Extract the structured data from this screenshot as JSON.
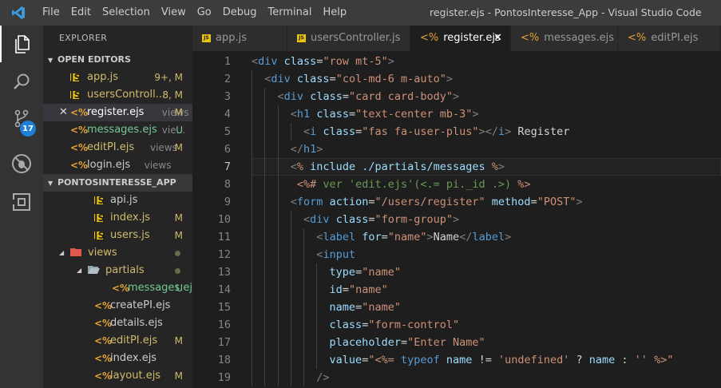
{
  "app": {
    "menu": [
      "File",
      "Edit",
      "Selection",
      "View",
      "Go",
      "Debug",
      "Terminal",
      "Help"
    ],
    "window_title": "register.ejs - PontosInteresse_App - Visual Studio Code"
  },
  "activity_bar": {
    "items": [
      {
        "icon": "files-icon",
        "active": true
      },
      {
        "icon": "search-icon",
        "active": false
      },
      {
        "icon": "source-control-icon",
        "active": false,
        "badge": "17"
      },
      {
        "icon": "debug-icon",
        "active": false
      },
      {
        "icon": "extensions-icon",
        "active": false
      }
    ]
  },
  "sidebar": {
    "title": "EXPLORER",
    "open_editors": {
      "title": "OPEN EDITORS",
      "items": [
        {
          "type": "js",
          "name": "app.js",
          "dir": "",
          "status": "9+, M"
        },
        {
          "type": "js",
          "name": "usersControll...",
          "dir": "",
          "status": "8, M"
        },
        {
          "type": "ejs",
          "name": "register.ejs",
          "dir": "views",
          "status": "M",
          "selected": true,
          "close": "✕"
        },
        {
          "type": "ejs",
          "name": "messages.ejs",
          "dir": "vie...",
          "status": "U"
        },
        {
          "type": "ejs",
          "name": "editPI.ejs",
          "dir": "views",
          "status": "M"
        },
        {
          "type": "ejs",
          "name": "login.ejs",
          "dir": "views",
          "status": ""
        }
      ]
    },
    "project": {
      "title": "PONTOSINTERESSE_APP",
      "items": [
        {
          "type": "js",
          "name": "api.js",
          "indent": 1,
          "status": ""
        },
        {
          "type": "js",
          "name": "index.js",
          "indent": 1,
          "status": "M"
        },
        {
          "type": "js",
          "name": "users.js",
          "indent": 1,
          "status": "M"
        },
        {
          "type": "folder-red",
          "name": "views",
          "indent": 0,
          "status": "dot",
          "open": true
        },
        {
          "type": "folder",
          "name": "partials",
          "indent": 1,
          "status": "dot",
          "open": true
        },
        {
          "type": "ejs",
          "name": "messages.ejs",
          "indent": 2,
          "status": "U"
        },
        {
          "type": "ejs",
          "name": "createPI.ejs",
          "indent": 1,
          "status": ""
        },
        {
          "type": "ejs",
          "name": "details.ejs",
          "indent": 1,
          "status": ""
        },
        {
          "type": "ejs",
          "name": "editPI.ejs",
          "indent": 1,
          "status": "M"
        },
        {
          "type": "ejs",
          "name": "index.ejs",
          "indent": 1,
          "status": ""
        },
        {
          "type": "ejs",
          "name": "layout.ejs",
          "indent": 1,
          "status": "M"
        }
      ]
    }
  },
  "tabs": [
    {
      "type": "js",
      "label": "app.js",
      "active": false
    },
    {
      "type": "js",
      "label": "usersController.js",
      "active": false
    },
    {
      "type": "ejs",
      "label": "register.ejs",
      "active": true,
      "close": "✕"
    },
    {
      "type": "ejs",
      "label": "messages.ejs",
      "active": false
    },
    {
      "type": "ejs",
      "label": "editPI.ejs",
      "active": false
    }
  ],
  "editor": {
    "current_line": 7,
    "lines": [
      {
        "n": "1",
        "ind": 0,
        "t": [
          [
            "p",
            "<"
          ],
          [
            "t",
            "div"
          ],
          [
            "x",
            " "
          ],
          [
            "a",
            "class"
          ],
          [
            "x",
            "="
          ],
          [
            "s",
            "\"row mt-5\""
          ],
          [
            "p",
            ">"
          ]
        ]
      },
      {
        "n": "2",
        "ind": 1,
        "t": [
          [
            "p",
            "<"
          ],
          [
            "t",
            "div"
          ],
          [
            "x",
            " "
          ],
          [
            "a",
            "class"
          ],
          [
            "x",
            "="
          ],
          [
            "s",
            "\"col-md-6 m-auto\""
          ],
          [
            "p",
            ">"
          ]
        ]
      },
      {
        "n": "3",
        "ind": 2,
        "t": [
          [
            "p",
            "<"
          ],
          [
            "t",
            "div"
          ],
          [
            "x",
            " "
          ],
          [
            "a",
            "class"
          ],
          [
            "x",
            "="
          ],
          [
            "s",
            "\"card card-body\""
          ],
          [
            "p",
            ">"
          ]
        ]
      },
      {
        "n": "4",
        "ind": 3,
        "t": [
          [
            "p",
            "<"
          ],
          [
            "t",
            "h1"
          ],
          [
            "x",
            " "
          ],
          [
            "a",
            "class"
          ],
          [
            "x",
            "="
          ],
          [
            "s",
            "\"text-center mb-3\""
          ],
          [
            "p",
            ">"
          ]
        ]
      },
      {
        "n": "5",
        "ind": 4,
        "t": [
          [
            "p",
            "<"
          ],
          [
            "t",
            "i"
          ],
          [
            "x",
            " "
          ],
          [
            "a",
            "class"
          ],
          [
            "x",
            "="
          ],
          [
            "s",
            "\"fas fa-user-plus\""
          ],
          [
            "p",
            ">"
          ],
          [
            "p",
            "</"
          ],
          [
            "t",
            "i"
          ],
          [
            "p",
            ">"
          ],
          [
            "x",
            " Register"
          ]
        ]
      },
      {
        "n": "6",
        "ind": 3,
        "t": [
          [
            "p",
            "</"
          ],
          [
            "t",
            "h1"
          ],
          [
            "p",
            ">"
          ]
        ]
      },
      {
        "n": "7",
        "ind": 3,
        "t": [
          [
            "p",
            "<"
          ],
          [
            "ed",
            "%"
          ],
          [
            "a",
            " include ./partials/messages "
          ],
          [
            "ed",
            "%"
          ],
          [
            "p",
            ">"
          ]
        ]
      },
      {
        "n": "8",
        "ind": 3,
        "t": [
          [
            "x",
            " "
          ],
          [
            "ed",
            "<%#"
          ],
          [
            "c",
            " ver 'edit.ejs'(<.= pi._id .>) "
          ],
          [
            "ed",
            "%>"
          ]
        ]
      },
      {
        "n": "9",
        "ind": 3,
        "t": [
          [
            "p",
            "<"
          ],
          [
            "t",
            "form"
          ],
          [
            "x",
            " "
          ],
          [
            "a",
            "action"
          ],
          [
            "x",
            "="
          ],
          [
            "s",
            "\"/users/register\""
          ],
          [
            "x",
            " "
          ],
          [
            "a",
            "method"
          ],
          [
            "x",
            "="
          ],
          [
            "s",
            "\"POST\""
          ],
          [
            "p",
            ">"
          ]
        ]
      },
      {
        "n": "10",
        "ind": 4,
        "t": [
          [
            "p",
            "<"
          ],
          [
            "t",
            "div"
          ],
          [
            "x",
            " "
          ],
          [
            "a",
            "class"
          ],
          [
            "x",
            "="
          ],
          [
            "s",
            "\"form-group\""
          ],
          [
            "p",
            ">"
          ]
        ]
      },
      {
        "n": "11",
        "ind": 5,
        "t": [
          [
            "p",
            "<"
          ],
          [
            "t",
            "label"
          ],
          [
            "x",
            " "
          ],
          [
            "a",
            "for"
          ],
          [
            "x",
            "="
          ],
          [
            "s",
            "\"name\""
          ],
          [
            "p",
            ">"
          ],
          [
            "x",
            "Name"
          ],
          [
            "p",
            "</"
          ],
          [
            "t",
            "label"
          ],
          [
            "p",
            ">"
          ]
        ]
      },
      {
        "n": "12",
        "ind": 5,
        "t": [
          [
            "p",
            "<"
          ],
          [
            "t",
            "input"
          ]
        ]
      },
      {
        "n": "13",
        "ind": 6,
        "t": [
          [
            "a",
            "type"
          ],
          [
            "x",
            "="
          ],
          [
            "s",
            "\"name\""
          ]
        ]
      },
      {
        "n": "14",
        "ind": 6,
        "t": [
          [
            "a",
            "id"
          ],
          [
            "x",
            "="
          ],
          [
            "s",
            "\"name\""
          ]
        ]
      },
      {
        "n": "15",
        "ind": 6,
        "t": [
          [
            "a",
            "name"
          ],
          [
            "x",
            "="
          ],
          [
            "s",
            "\"name\""
          ]
        ]
      },
      {
        "n": "16",
        "ind": 6,
        "t": [
          [
            "a",
            "class"
          ],
          [
            "x",
            "="
          ],
          [
            "s",
            "\"form-control\""
          ]
        ]
      },
      {
        "n": "17",
        "ind": 6,
        "t": [
          [
            "a",
            "placeholder"
          ],
          [
            "x",
            "="
          ],
          [
            "s",
            "\"Enter Name\""
          ]
        ]
      },
      {
        "n": "18",
        "ind": 6,
        "t": [
          [
            "a",
            "value"
          ],
          [
            "x",
            "="
          ],
          [
            "s",
            "\""
          ],
          [
            "ed",
            "<%="
          ],
          [
            "x",
            " "
          ],
          [
            "k",
            "typeof"
          ],
          [
            "x",
            " "
          ],
          [
            "a",
            "name"
          ],
          [
            "x",
            " != "
          ],
          [
            "s",
            "'undefined'"
          ],
          [
            "x",
            " ? "
          ],
          [
            "a",
            "name"
          ],
          [
            "x",
            " : "
          ],
          [
            "s",
            "''"
          ],
          [
            "x",
            " "
          ],
          [
            "ed",
            "%>"
          ],
          [
            "s",
            "\""
          ]
        ]
      },
      {
        "n": "19",
        "ind": 5,
        "t": [
          [
            "p",
            "/>"
          ]
        ]
      }
    ]
  }
}
